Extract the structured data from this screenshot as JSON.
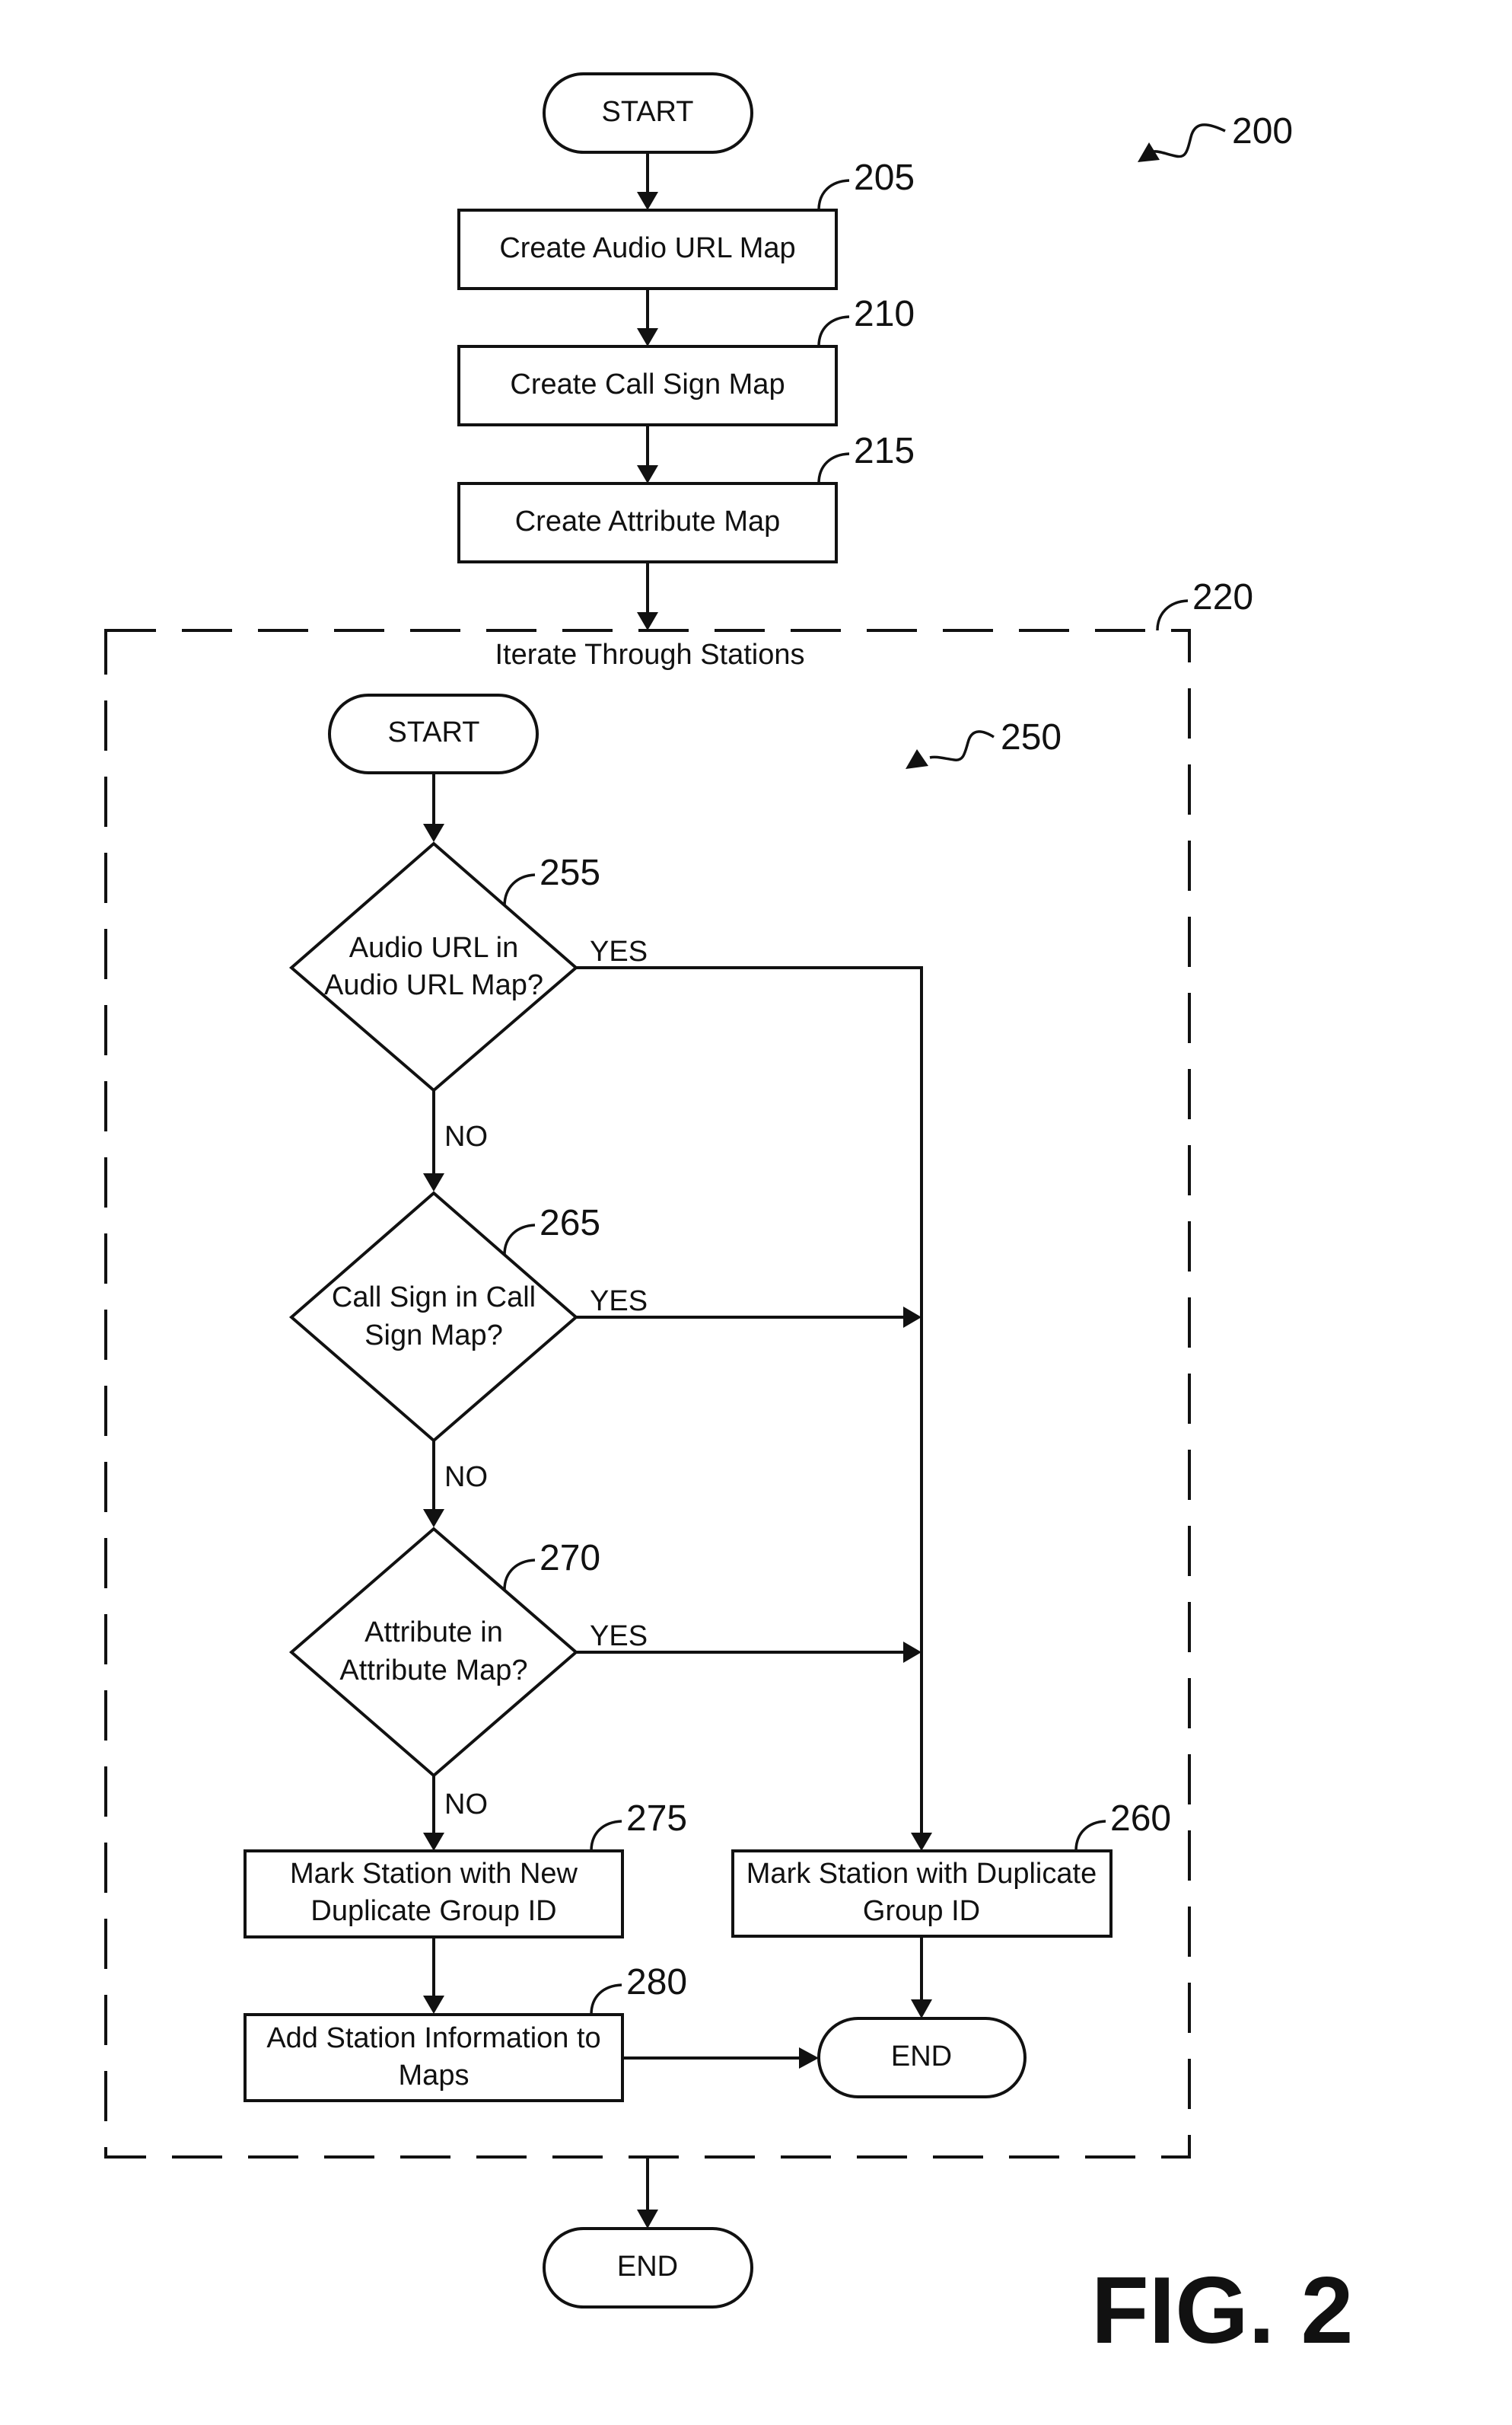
{
  "figure": {
    "title": "FIG. 2",
    "outer_ref": "200",
    "outer_flow": {
      "start": "START",
      "steps": [
        {
          "ref": "205",
          "label": "Create Audio URL Map"
        },
        {
          "ref": "210",
          "label": "Create Call Sign Map"
        },
        {
          "ref": "215",
          "label": "Create Attribute Map"
        }
      ],
      "loop": {
        "ref": "220",
        "label": "Iterate Through Stations"
      },
      "end": "END"
    },
    "inner_flow": {
      "ref": "250",
      "start": "START",
      "decisions": [
        {
          "ref": "255",
          "lines": [
            "Audio URL in",
            "Audio URL Map?"
          ],
          "yes": "YES",
          "no": "NO"
        },
        {
          "ref": "265",
          "lines": [
            "Call Sign in Call",
            "Sign Map?"
          ],
          "yes": "YES",
          "no": "NO"
        },
        {
          "ref": "270",
          "lines": [
            "Attribute in",
            "Attribute Map?"
          ],
          "yes": "YES",
          "no": "NO"
        }
      ],
      "new_group": {
        "ref": "275",
        "lines": [
          "Mark Station with New",
          "Duplicate Group ID"
        ]
      },
      "add_info": {
        "ref": "280",
        "lines": [
          "Add Station Information to",
          "Maps"
        ]
      },
      "duplicate": {
        "ref": "260",
        "lines": [
          "Mark Station with Duplicate",
          "Group ID"
        ]
      },
      "end": "END"
    }
  }
}
